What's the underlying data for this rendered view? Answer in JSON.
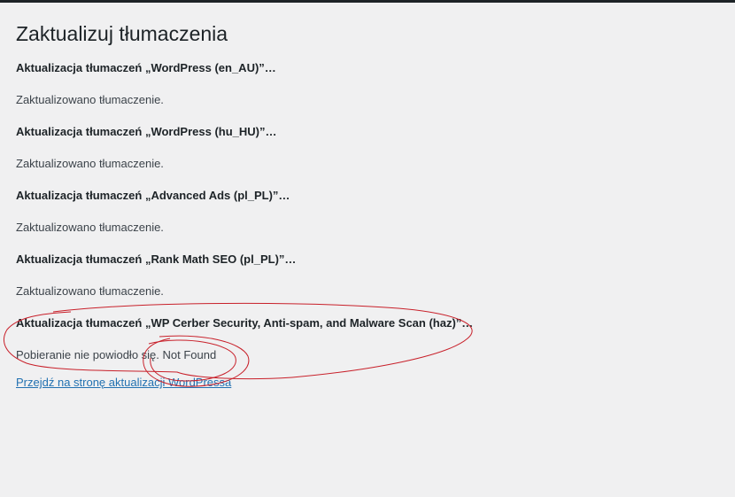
{
  "page": {
    "title": "Zaktualizuj tłumaczenia"
  },
  "steps": [
    {
      "heading": "Aktualizacja tłumaczeń „WordPress (en_AU)”…",
      "result": "Zaktualizowano tłumaczenie."
    },
    {
      "heading": "Aktualizacja tłumaczeń „WordPress (hu_HU)”…",
      "result": "Zaktualizowano tłumaczenie."
    },
    {
      "heading": "Aktualizacja tłumaczeń „Advanced Ads (pl_PL)”…",
      "result": "Zaktualizowano tłumaczenie."
    },
    {
      "heading": "Aktualizacja tłumaczeń „Rank Math SEO (pl_PL)”…",
      "result": "Zaktualizowano tłumaczenie."
    },
    {
      "heading": "Aktualizacja tłumaczeń „WP Cerber Security, Anti-spam, and Malware Scan (haz)”…",
      "result": "Pobieranie nie powiodło się. Not Found"
    }
  ],
  "footer": {
    "link_label": "Przejdź na stronę aktualizacji WordPressa"
  },
  "colors": {
    "background": "#f0f0f1",
    "link": "#2271b1",
    "annotation": "#c8202a"
  }
}
